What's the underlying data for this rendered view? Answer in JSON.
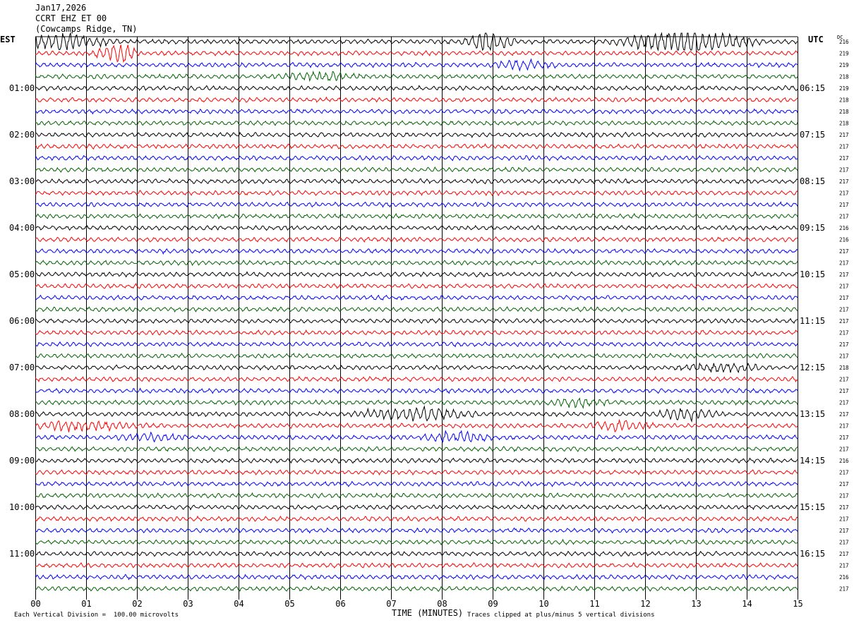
{
  "header": {
    "date": "Jan17,2026",
    "station": "CCRT EHZ ET 00",
    "location": "(Cowcamps Ridge, TN)"
  },
  "left_tz": "EST",
  "right_tz": "UTC",
  "dc_label": "DC",
  "footer": {
    "scale": "Each Vertical Division =  100.00 microvolts",
    "x_title": "TIME (MINUTES)",
    "clip_note": "Traces clipped at plus/minus 5 vertical divisions"
  },
  "colors": {
    "trace_cycle": [
      "#000000",
      "#ff0000",
      "#0000ff",
      "#006400"
    ],
    "grid": "#000000",
    "background": "#ffffff"
  },
  "chart_data": {
    "type": "line",
    "title": "",
    "xlabel": "TIME (MINUTES)",
    "ylabel": "",
    "xlim": [
      0,
      15
    ],
    "x_ticks": [
      "00",
      "01",
      "02",
      "03",
      "04",
      "05",
      "06",
      "07",
      "08",
      "09",
      "10",
      "11",
      "12",
      "13",
      "14",
      "15"
    ],
    "rows": 48,
    "minutes_per_row": 15,
    "left_hour_labels": [
      "01:00",
      "02:00",
      "03:00",
      "04:00",
      "05:00",
      "06:00",
      "07:00",
      "08:00",
      "09:00",
      "10:00",
      "11:00"
    ],
    "right_hour_labels": [
      "06:15",
      "07:15",
      "08:15",
      "09:15",
      "10:15",
      "11:15",
      "12:15",
      "13:15",
      "14:15",
      "15:15",
      "16:15"
    ],
    "dc_offsets": [
      216,
      219,
      219,
      218,
      219,
      218,
      218,
      218,
      217,
      217,
      217,
      217,
      217,
      217,
      217,
      217,
      216,
      216,
      217,
      217,
      217,
      217,
      217,
      217,
      217,
      217,
      217,
      217,
      218,
      217,
      217,
      217,
      217,
      217,
      217,
      217,
      216,
      217,
      217,
      217,
      217,
      217,
      217,
      217,
      217,
      217,
      216,
      217
    ],
    "events": [
      {
        "row": 0,
        "minute": 0.5,
        "duration": 1.2,
        "strength": 2.2
      },
      {
        "row": 0,
        "minute": 8.9,
        "duration": 0.6,
        "strength": 2.6
      },
      {
        "row": 0,
        "minute": 12.8,
        "duration": 1.6,
        "strength": 2.8
      },
      {
        "row": 1,
        "minute": 1.6,
        "duration": 0.5,
        "strength": 2.8
      },
      {
        "row": 2,
        "minute": 9.6,
        "duration": 0.8,
        "strength": 1.6
      },
      {
        "row": 3,
        "minute": 5.6,
        "duration": 1.0,
        "strength": 1.5
      },
      {
        "row": 28,
        "minute": 13.5,
        "duration": 1.0,
        "strength": 1.6
      },
      {
        "row": 31,
        "minute": 10.7,
        "duration": 0.8,
        "strength": 1.5
      },
      {
        "row": 32,
        "minute": 7.5,
        "duration": 1.4,
        "strength": 2.0
      },
      {
        "row": 32,
        "minute": 12.8,
        "duration": 0.8,
        "strength": 1.8
      },
      {
        "row": 33,
        "minute": 0.8,
        "duration": 1.6,
        "strength": 1.6
      },
      {
        "row": 33,
        "minute": 11.5,
        "duration": 0.8,
        "strength": 1.6
      },
      {
        "row": 34,
        "minute": 2.3,
        "duration": 0.8,
        "strength": 1.5
      },
      {
        "row": 34,
        "minute": 8.3,
        "duration": 0.8,
        "strength": 1.8
      }
    ]
  }
}
